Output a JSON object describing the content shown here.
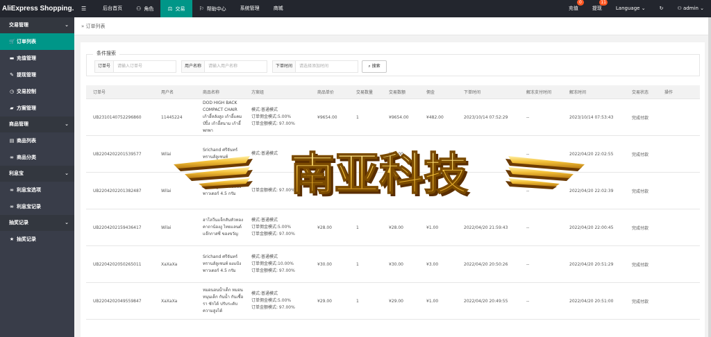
{
  "brand": "AliExpress Shopping...",
  "topnav": [
    {
      "label": "",
      "icon": "menu-icon"
    },
    {
      "label": "后台首页",
      "icon": ""
    },
    {
      "label": "角色",
      "icon": "user-icon"
    },
    {
      "label": "交易",
      "icon": "scale-icon"
    },
    {
      "label": "帮助中心",
      "icon": "flag-icon"
    },
    {
      "label": "系统管理",
      "icon": ""
    },
    {
      "label": "商城",
      "icon": ""
    }
  ],
  "topright": {
    "recharge": "充值",
    "recharge_badge": "0",
    "withdraw": "提现",
    "withdraw_badge": "11",
    "language": "Language",
    "user": "admin"
  },
  "sidebar": [
    {
      "group": "交易管理",
      "items": [
        {
          "label": "订单列表",
          "icon": "cart-icon"
        },
        {
          "label": "充值管理",
          "icon": "chat-icon"
        },
        {
          "label": "提现管理",
          "icon": "wrench-icon"
        },
        {
          "label": "交易控制",
          "icon": "dashboard-icon"
        },
        {
          "label": "方案管理",
          "icon": "folder-icon"
        }
      ]
    },
    {
      "group": "商品管理",
      "items": [
        {
          "label": "商品列表",
          "icon": "cart-icon"
        },
        {
          "label": "商品分类",
          "icon": "link-icon"
        }
      ]
    },
    {
      "group": "利息宝",
      "items": [
        {
          "label": "利息宝选项",
          "icon": "link-icon"
        },
        {
          "label": "利息宝记录",
          "icon": "link-icon"
        }
      ]
    },
    {
      "group": "抽奖记录",
      "items": [
        {
          "label": "抽奖记录",
          "icon": "star-icon"
        }
      ]
    }
  ],
  "breadcrumb": "订单列表",
  "search": {
    "legend": "条件搜索",
    "order_label": "订单号",
    "order_ph": "请输入订单号",
    "user_label": "用户名称",
    "user_ph": "请输入用户名称",
    "time_label": "下单时间",
    "time_ph": "请选择添加时间",
    "button": "搜索"
  },
  "columns": [
    "订单号",
    "用户名",
    "商品名称",
    "方案组",
    "商品单价",
    "交易数量",
    "交易数额",
    "佣金",
    "下单时间",
    "解冻支付时间",
    "解冻时间",
    "交易状态",
    "操作"
  ],
  "rows": [
    {
      "id": "UB2310140752296860",
      "user": "11445224",
      "product": "DOD HIGH BACK COMPACT CHAIR เก้าอี้หลังสูง เก้าอี้แคมป์ปิ้ง เก้าอี้สนาม เก้าอี้พกพา",
      "scheme": [
        "模式:普通模式",
        "订单佣金模式:5.00%",
        "订单金额模式: 97.00%"
      ],
      "price": "¥9654.00",
      "qty": "1",
      "amount": "¥9654.00",
      "commission": "¥482.00",
      "order_time": "2023/10/14 07:52:29",
      "pay_time": "--",
      "unfreeze": "2023/10/14 07:53:43",
      "status": "完成付款",
      "op": ""
    },
    {
      "id": "UB2204202201539577",
      "user": "Wilai",
      "product": "Srichand ศรีจันทร์ ทรานส์ลูเซนท์",
      "scheme": [
        "模式:普通模式",
        "",
        ""
      ],
      "price": "",
      "qty": "",
      "amount": "¥43.00",
      "commission": "",
      "order_time": "",
      "pay_time": "--",
      "unfreeze": "2022/04/20 22:02:55",
      "status": "完成付款",
      "op": ""
    },
    {
      "id": "UB2204202201382487",
      "user": "Wilai",
      "product": "ทรานส์ลูเซนท์ ผงแป้ง พาวเดอร์ 4.5 กรัม",
      "scheme": [
        "",
        "",
        "订单金额模式: 97.00%"
      ],
      "price": "",
      "qty": "",
      "amount": "",
      "commission": "¥1.00",
      "order_time": "",
      "pay_time": "--",
      "unfreeze": "2022/04/20 22:02:39",
      "status": "完成付款",
      "op": ""
    },
    {
      "id": "UB2204202159436417",
      "user": "Wilai",
      "product": "ฮาโลวีนแจ็กสันหัวทองคาถาน้องงู ไทยแลนด์แจ๊กกาสซี่ ของขวัญ",
      "scheme": [
        "模式:普通模式",
        "订单佣金模式:5.00%",
        "订单金额模式: 97.00%"
      ],
      "price": "¥28.00",
      "qty": "1",
      "amount": "¥28.00",
      "commission": "¥1.00",
      "order_time": "2022/04/20 21:59:43",
      "pay_time": "--",
      "unfreeze": "2022/04/20 22:00:45",
      "status": "完成付款",
      "op": ""
    },
    {
      "id": "UB2204202050265011",
      "user": "XaXaXa",
      "product": "Srichand ศรีจันทร์ ทรานส์ลูเซนท์ ผงแป้ง พาวเดอร์ 4.5 กรัม",
      "scheme": [
        "模式:普通模式",
        "订单佣金模式:10.00%",
        "订单金额模式: 97.00%"
      ],
      "price": "¥30.00",
      "qty": "1",
      "amount": "¥30.00",
      "commission": "¥3.00",
      "order_time": "2022/04/20 20:50:26",
      "pay_time": "--",
      "unfreeze": "2022/04/20 20:51:29",
      "status": "完成付款",
      "op": ""
    },
    {
      "id": "UB2204202049559847",
      "user": "XaXaXa",
      "product": "หมอนอนน้ำเด็ก หมอนหนุนเด็ก กันน้ำ กันเชื้อรา ซักได้ ปรับระดับความสูงได้",
      "scheme": [
        "模式:普通模式",
        "订单佣金模式:5.00%",
        "订单金额模式: 97.00%"
      ],
      "price": "¥29.00",
      "qty": "1",
      "amount": "¥29.00",
      "commission": "¥1.00",
      "order_time": "2022/04/20 20:49:55",
      "pay_time": "--",
      "unfreeze": "2022/04/20 20:51:00",
      "status": "完成付款",
      "op": ""
    }
  ],
  "watermark": "南亚科技",
  "colors": {
    "topbar": "#23262e",
    "sidebar": "#393d49",
    "accent": "#009688",
    "badge": "#ff5722"
  }
}
